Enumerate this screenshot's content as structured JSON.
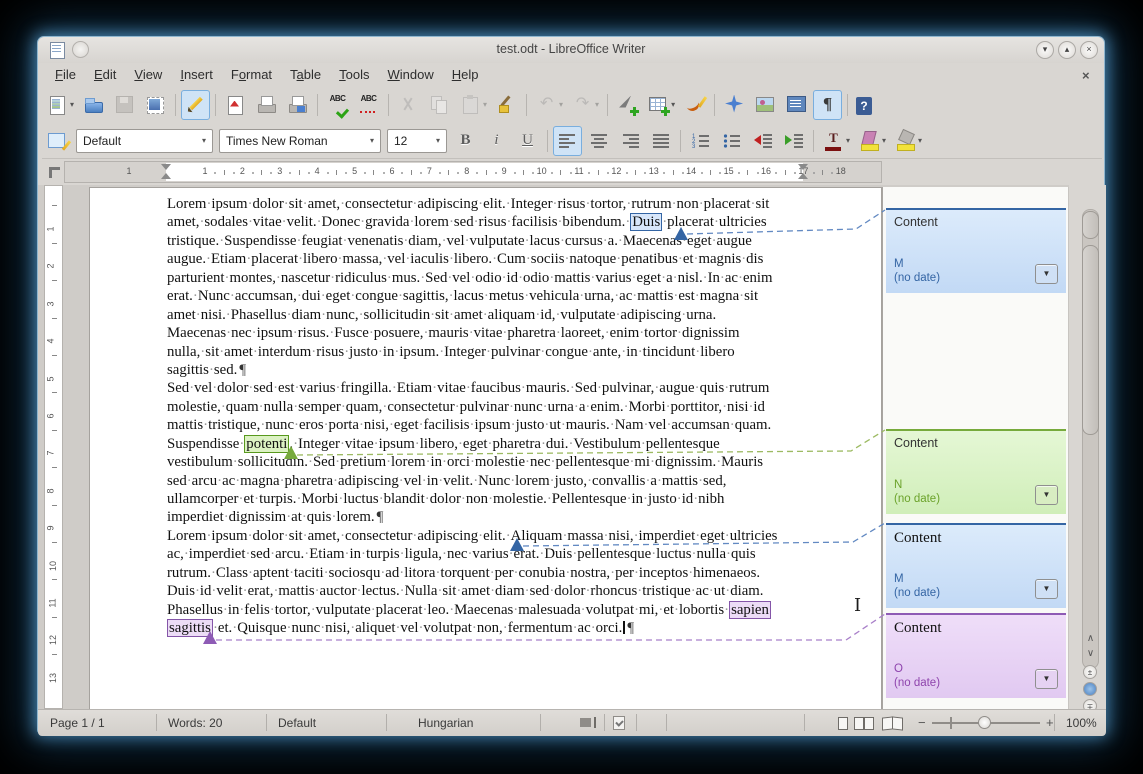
{
  "window": {
    "title": "test.odt - LibreOffice Writer"
  },
  "menubar": {
    "items": [
      {
        "label": "File",
        "u": 0
      },
      {
        "label": "Edit",
        "u": 0
      },
      {
        "label": "View",
        "u": 0
      },
      {
        "label": "Insert",
        "u": 0
      },
      {
        "label": "Format",
        "u": 1
      },
      {
        "label": "Table",
        "u": 1
      },
      {
        "label": "Tools",
        "u": 0
      },
      {
        "label": "Window",
        "u": 0
      },
      {
        "label": "Help",
        "u": 0
      }
    ]
  },
  "toolbars": {
    "standard": [
      {
        "name": "new-document",
        "dropdown": true
      },
      {
        "name": "open"
      },
      {
        "name": "save",
        "disabled": true
      },
      {
        "name": "email-document"
      },
      {
        "sep": true
      },
      {
        "name": "edit-mode",
        "active": true
      },
      {
        "sep": true
      },
      {
        "name": "export-pdf"
      },
      {
        "name": "print-direct"
      },
      {
        "name": "print-preview"
      },
      {
        "sep": true
      },
      {
        "name": "spellcheck",
        "glyph": "ABC"
      },
      {
        "name": "auto-spellcheck",
        "glyph": "ABC"
      },
      {
        "sep": true
      },
      {
        "name": "cut",
        "disabled": true
      },
      {
        "name": "copy",
        "disabled": true
      },
      {
        "name": "paste",
        "disabled": true,
        "dropdown": true
      },
      {
        "name": "clone-formatting"
      },
      {
        "sep": true
      },
      {
        "name": "undo",
        "disabled": true,
        "dropdown": true,
        "glyph": "↶"
      },
      {
        "name": "redo",
        "disabled": true,
        "dropdown": true,
        "glyph": "↷"
      },
      {
        "sep": true
      },
      {
        "name": "insert-hyperlink"
      },
      {
        "name": "insert-table",
        "dropdown": true
      },
      {
        "name": "draw-functions"
      },
      {
        "sep": true
      },
      {
        "name": "navigator"
      },
      {
        "name": "gallery"
      },
      {
        "name": "data-sources"
      },
      {
        "name": "formatting-marks",
        "active": true,
        "glyph": "¶"
      },
      {
        "sep": true
      },
      {
        "name": "help",
        "glyph": "?"
      }
    ],
    "formatting": {
      "style_selector": "Default",
      "font_selector": "Times New Roman",
      "size_selector": "12",
      "buttons": [
        {
          "name": "bold",
          "glyph": "B"
        },
        {
          "name": "italic",
          "glyph": "i"
        },
        {
          "name": "underline",
          "glyph": "U"
        },
        {
          "sep": true
        },
        {
          "name": "align-left",
          "active": true
        },
        {
          "name": "align-center"
        },
        {
          "name": "align-right"
        },
        {
          "name": "justify"
        },
        {
          "sep": true
        },
        {
          "name": "numbered-list"
        },
        {
          "name": "bullet-list"
        },
        {
          "name": "decrease-indent"
        },
        {
          "name": "increase-indent"
        },
        {
          "sep": true
        },
        {
          "name": "font-color",
          "glyph": "T",
          "dropdown": true
        },
        {
          "name": "highlight-color",
          "dropdown": true
        },
        {
          "name": "background-color",
          "dropdown": true
        }
      ]
    }
  },
  "ruler": {
    "h_numbers": [
      1,
      2,
      3,
      4,
      5,
      6,
      7,
      8,
      9,
      10,
      11,
      12,
      13,
      14,
      15,
      16,
      17,
      18
    ],
    "h_margin_left_number": "1",
    "v_numbers": [
      1,
      2,
      3,
      4,
      5,
      6,
      7,
      8,
      9,
      10,
      11,
      12,
      13
    ]
  },
  "document": {
    "paragraphs": [
      {
        "lines": [
          {
            "segs": [
              {
                "t": "Lorem ipsum dolor sit amet, consectetur adipiscing elit. Integer risus tortor, rutrum non placerat sit"
              }
            ]
          },
          {
            "segs": [
              {
                "t": "amet, sodales vitae velit. Donec gravida lorem sed risus facilisis bibendum. "
              },
              {
                "t": "Duis",
                "hl": "blue"
              },
              {
                "t": " placerat ultricies"
              }
            ]
          },
          {
            "segs": [
              {
                "t": "tristique. Suspendisse feugiat venenatis diam, vel vulputate lacus cursus a. Maecenas eget augue"
              }
            ]
          },
          {
            "segs": [
              {
                "t": "augue. Etiam placerat libero massa, vel iaculis libero. Cum sociis natoque penatibus et magnis dis"
              }
            ]
          },
          {
            "segs": [
              {
                "t": "parturient montes, nascetur ridiculus mus. Sed vel odio id odio mattis varius eget a nisl. In ac enim"
              }
            ]
          },
          {
            "segs": [
              {
                "t": "erat. Nunc accumsan, dui eget congue sagittis, lacus metus vehicula urna, ac mattis est magna sit"
              }
            ]
          },
          {
            "segs": [
              {
                "t": "amet nisi. Phasellus diam nunc, sollicitudin sit amet aliquam id, vulputate adipiscing urna."
              }
            ]
          },
          {
            "segs": [
              {
                "t": "Maecenas nec ipsum risus. Fusce posuere, mauris vitae pharetra laoreet, enim tortor dignissim"
              }
            ]
          },
          {
            "segs": [
              {
                "t": "nulla, sit amet interdum risus justo in ipsum. Integer pulvinar congue ante, in tincidunt libero"
              }
            ]
          },
          {
            "segs": [
              {
                "t": "sagittis sed."
              }
            ],
            "pilcrow": true
          }
        ]
      },
      {
        "lines": [
          {
            "segs": [
              {
                "t": "Sed vel dolor sed est varius fringilla. Etiam vitae faucibus mauris. Sed pulvinar, augue quis rutrum"
              }
            ]
          },
          {
            "segs": [
              {
                "t": "molestie, quam nulla semper quam, consectetur pulvinar nunc urna a enim. Morbi porttitor, nisi id"
              }
            ]
          },
          {
            "segs": [
              {
                "t": "mattis tristique, nunc eros porta nisi, eget facilisis ipsum justo ut mauris. Nam vel accumsan quam."
              }
            ]
          },
          {
            "segs": [
              {
                "t": "Suspendisse "
              },
              {
                "t": "potenti",
                "hl": "green"
              },
              {
                "t": ". Integer vitae ipsum libero, eget pharetra dui. Vestibulum pellentesque"
              }
            ]
          },
          {
            "segs": [
              {
                "t": "vestibulum sollicitudin. Sed pretium lorem in orci molestie nec pellentesque mi dignissim. Mauris"
              }
            ]
          },
          {
            "segs": [
              {
                "t": "sed arcu ac magna pharetra adipiscing vel in velit. Nunc lorem justo, convallis a mattis sed,"
              }
            ]
          },
          {
            "segs": [
              {
                "t": "ullamcorper et turpis. Morbi luctus blandit dolor non molestie. Pellentesque in justo id nibh"
              }
            ]
          },
          {
            "segs": [
              {
                "t": "imperdiet dignissim at quis lorem."
              }
            ],
            "pilcrow": true
          }
        ]
      },
      {
        "lines": [
          {
            "segs": [
              {
                "t": "Lorem ipsum dolor sit amet, consectetur adipiscing elit. Aliquam massa nisi, imperdiet eget ultricies"
              }
            ]
          },
          {
            "segs": [
              {
                "t": "ac, imperdiet sed arcu. Etiam in turpis ligula, nec varius erat. Duis pellentesque luctus nulla quis"
              }
            ]
          },
          {
            "segs": [
              {
                "t": "rutrum. Class aptent taciti sociosqu ad litora torquent per conubia nostra, per inceptos himenaeos."
              }
            ]
          },
          {
            "segs": [
              {
                "t": "Duis id velit erat, mattis auctor lectus. Nulla sit amet diam sed dolor rhoncus tristique ac ut diam."
              }
            ]
          },
          {
            "segs": [
              {
                "t": "Phasellus in felis tortor, vulputate placerat leo. Maecenas malesuada volutpat mi, et lobortis "
              },
              {
                "t": "sapien",
                "hl": "purple"
              }
            ]
          },
          {
            "segs": [
              {
                "t": "sagittis",
                "hl": "purple"
              },
              {
                "t": " et. Quisque nunc nisi, aliquet vel volutpat non, fermentum ac orci."
              }
            ],
            "pilcrow": true,
            "caret": true
          }
        ]
      }
    ]
  },
  "comments": [
    {
      "label": "Content",
      "author": "M",
      "date": "(no date)",
      "color": "blue",
      "serif": false
    },
    {
      "label": "Content",
      "author": "N",
      "date": "(no date)",
      "color": "green",
      "serif": false
    },
    {
      "label": "Content",
      "author": "M",
      "date": "(no date)",
      "color": "blue",
      "serif": true
    },
    {
      "label": "Content",
      "author": "O",
      "date": "(no date)",
      "color": "purple",
      "serif": true
    }
  ],
  "colors": {
    "blue": {
      "line": "#3465a4",
      "dash": "#6289c2",
      "bg1": "#dcebfb",
      "bg2": "#c2d9f5",
      "text": "#3465a4",
      "btn": "#cfe0f5",
      "hl_bg": "#d8e7fb",
      "hl_border": "#3465a4"
    },
    "green": {
      "line": "#77aa3c",
      "dash": "#9cba62",
      "bg1": "#e5f7d5",
      "bg2": "#d0eeb9",
      "text": "#6ba22a",
      "btn": "#d8edc2",
      "hl_bg": "#dcf2c3",
      "hl_border": "#58991d"
    },
    "purple": {
      "line": "#8e5bb5",
      "dash": "#a87fc9",
      "bg1": "#efdef9",
      "bg2": "#e1c9f1",
      "text": "#8e44ad",
      "btn": "#e5d2f2",
      "hl_bg": "#ecdcf6",
      "hl_border": "#8455a8"
    }
  },
  "statusbar": {
    "page": "Page 1 / 1",
    "words": "Words: 20",
    "style": "Default",
    "language": "Hungarian",
    "zoom": "100%"
  }
}
